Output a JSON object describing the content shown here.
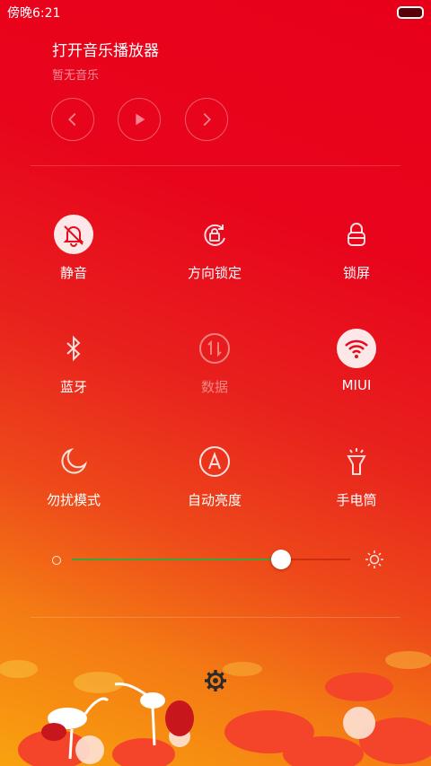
{
  "status_bar": {
    "time": "傍晚6:21"
  },
  "music": {
    "title": "打开音乐播放器",
    "subtitle": "暂无音乐"
  },
  "toggles": [
    {
      "label": "静音",
      "icon": "bell-off-icon",
      "active": true
    },
    {
      "label": "方向锁定",
      "icon": "rotation-lock-icon",
      "active": false
    },
    {
      "label": "锁屏",
      "icon": "lock-icon",
      "active": false
    },
    {
      "label": "蓝牙",
      "icon": "bluetooth-icon",
      "active": false
    },
    {
      "label": "数据",
      "icon": "mobile-data-icon",
      "active": false,
      "disabled": true
    },
    {
      "label": "MIUI",
      "icon": "wifi-icon",
      "active": true
    },
    {
      "label": "勿扰模式",
      "icon": "moon-icon",
      "active": false
    },
    {
      "label": "自动亮度",
      "icon": "auto-brightness-icon",
      "active": false
    },
    {
      "label": "手电筒",
      "icon": "flashlight-icon",
      "active": false
    }
  ],
  "brightness": {
    "level": 0.75,
    "fill_color": "#3fa33a"
  }
}
